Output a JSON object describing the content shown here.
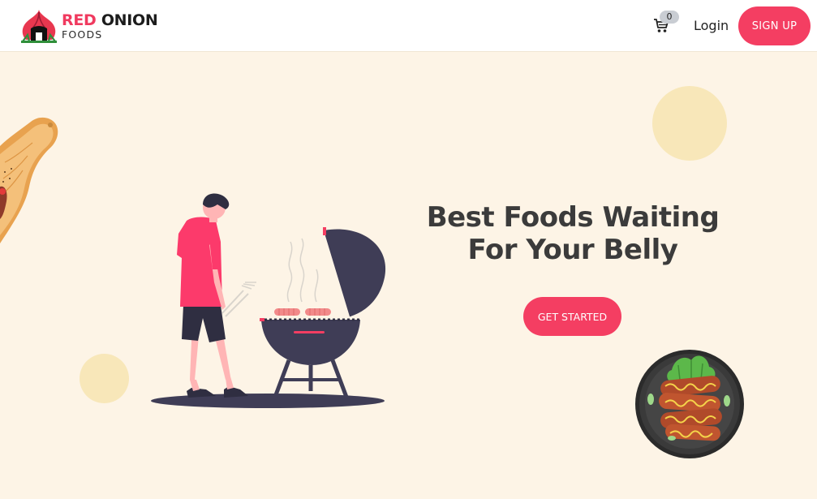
{
  "brand": {
    "name_part1": "RED",
    "name_part2": "ONION",
    "tagline": "FOODS"
  },
  "nav": {
    "cart_icon": "cart-icon",
    "cart_count": "0",
    "login_label": "Login",
    "signup_label": "SIGN UP"
  },
  "hero": {
    "title_line1": "Best Foods Waiting",
    "title_line2": "For Your Belly",
    "cta_label": "GET STARTED"
  },
  "colors": {
    "accent": "#f43e62",
    "background": "#fdf4e6",
    "title": "#3b3b3b",
    "deco_circle": "#f8e7b9"
  },
  "illustrations": [
    "cutting-board-illustration",
    "bbq-griller-illustration",
    "sausage-plate-illustration"
  ]
}
